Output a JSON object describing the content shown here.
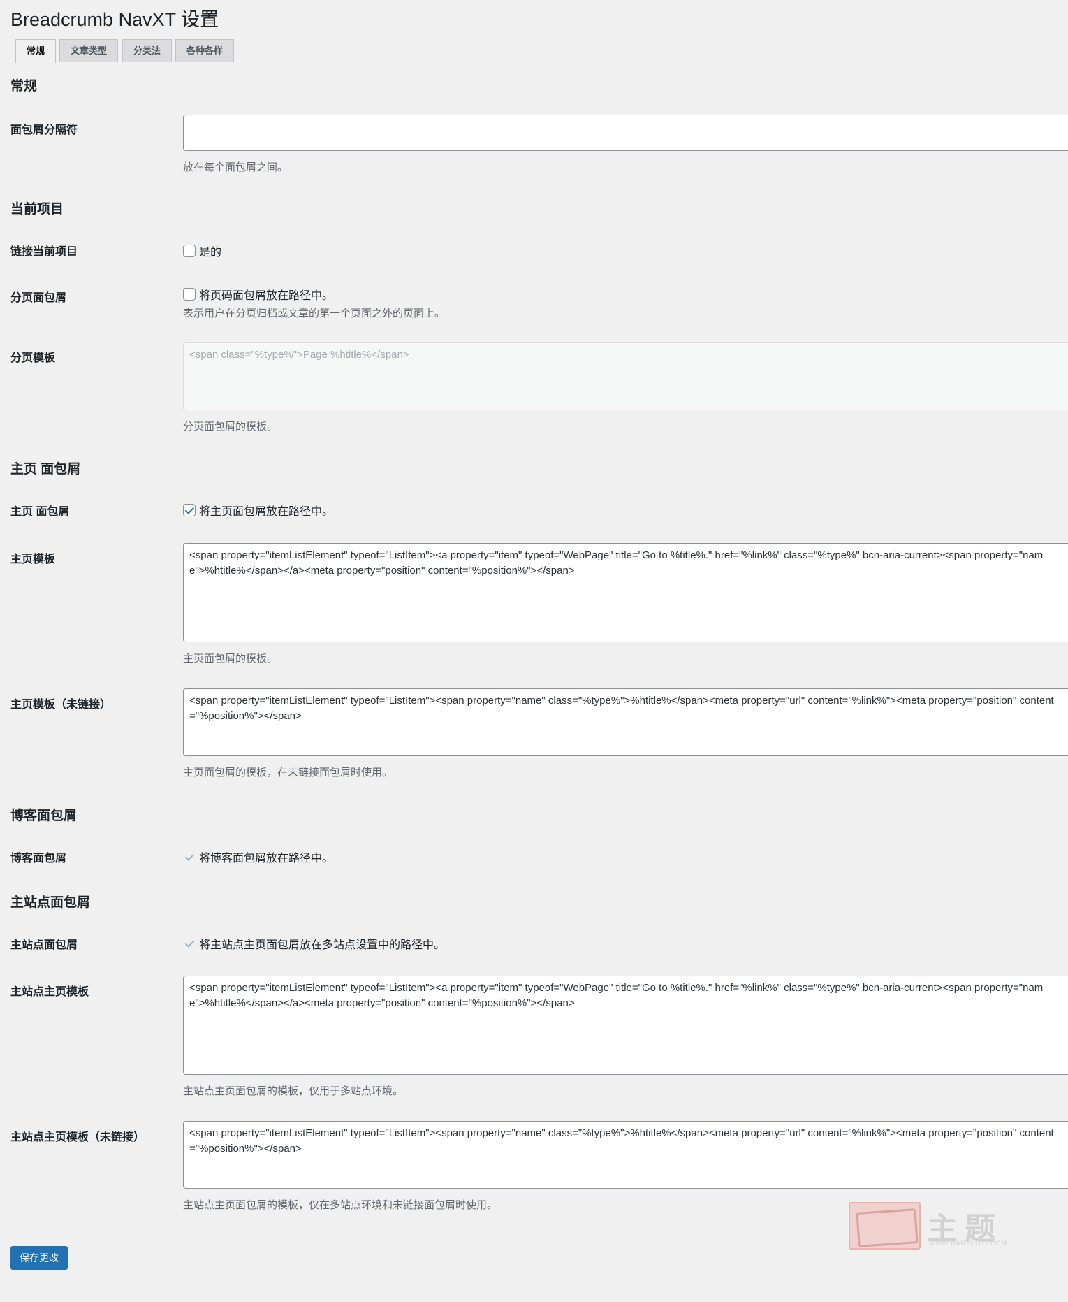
{
  "title": "Breadcrumb NavXT 设置",
  "tabs": [
    {
      "label": "常规",
      "active": true
    },
    {
      "label": "文章类型",
      "active": false
    },
    {
      "label": "分类法",
      "active": false
    },
    {
      "label": "各种各样",
      "active": false
    }
  ],
  "general": {
    "section_title": "常规",
    "separator": {
      "label": "面包屑分隔符",
      "value": "",
      "description": "放在每个面包屑之间。"
    }
  },
  "current_item": {
    "section_title": "当前项目",
    "link_current": {
      "label": "链接当前项目",
      "checkbox_label": "是的",
      "checked": false
    },
    "paged": {
      "label": "分页面包屑",
      "checkbox_label": "将页码面包屑放在路径中。",
      "checked": false,
      "description": "表示用户在分页归档或文章的第一个页面之外的页面上。"
    },
    "paged_template": {
      "label": "分页模板",
      "value": "<span class=\"%type%\">Page %htitle%</span>",
      "description": "分页面包屑的模板。"
    }
  },
  "home": {
    "section_title": "主页 面包屑",
    "home_display": {
      "label": "主页 面包屑",
      "checkbox_label": "将主页面包屑放在路径中。",
      "checked": true
    },
    "home_template": {
      "label": "主页模板",
      "value": "<span property=\"itemListElement\" typeof=\"ListItem\"><a property=\"item\" typeof=\"WebPage\" title=\"Go to %title%.\" href=\"%link%\" class=\"%type%\" bcn-aria-current><span property=\"name\">%htitle%</span></a><meta property=\"position\" content=\"%position%\"></span>",
      "description": "主页面包屑的模板。"
    },
    "home_template_unlinked": {
      "label": "主页模板（未链接）",
      "value": "<span property=\"itemListElement\" typeof=\"ListItem\"><span property=\"name\" class=\"%type%\">%htitle%</span><meta property=\"url\" content=\"%link%\"><meta property=\"position\" content=\"%position%\"></span>",
      "description": "主页面包屑的模板，在未链接面包屑时使用。"
    }
  },
  "blog": {
    "section_title": "博客面包屑",
    "blog_display": {
      "label": "博客面包屑",
      "checkbox_label": "将博客面包屑放在路径中。",
      "checked": true
    }
  },
  "mainsite": {
    "section_title": "主站点面包屑",
    "mainsite_display": {
      "label": "主站点面包屑",
      "checkbox_label": "将主站点主页面包屑放在多站点设置中的路径中。",
      "checked": true
    },
    "mainsite_template": {
      "label": "主站点主页模板",
      "value": "<span property=\"itemListElement\" typeof=\"ListItem\"><a property=\"item\" typeof=\"WebPage\" title=\"Go to %title%.\" href=\"%link%\" class=\"%type%\" bcn-aria-current><span property=\"name\">%htitle%</span></a><meta property=\"position\" content=\"%position%\"></span>",
      "description": "主站点主页面包屑的模板，仅用于多站点环境。"
    },
    "mainsite_template_unlinked": {
      "label": "主站点主页模板（未链接）",
      "value": "<span property=\"itemListElement\" typeof=\"ListItem\"><span property=\"name\" class=\"%type%\">%htitle%</span><meta property=\"url\" content=\"%link%\"><meta property=\"position\" content=\"%position%\"></span>",
      "description": "主站点主页面包屑的模板，仅在多站点环境和未链接面包屑时使用。"
    }
  },
  "save_button": "保存更改",
  "watermark": {
    "text": "主题",
    "sub": "WWW.BANZHUTI.COM"
  },
  "colors": {
    "accent": "#2271b1",
    "background": "#f0f0f1"
  }
}
